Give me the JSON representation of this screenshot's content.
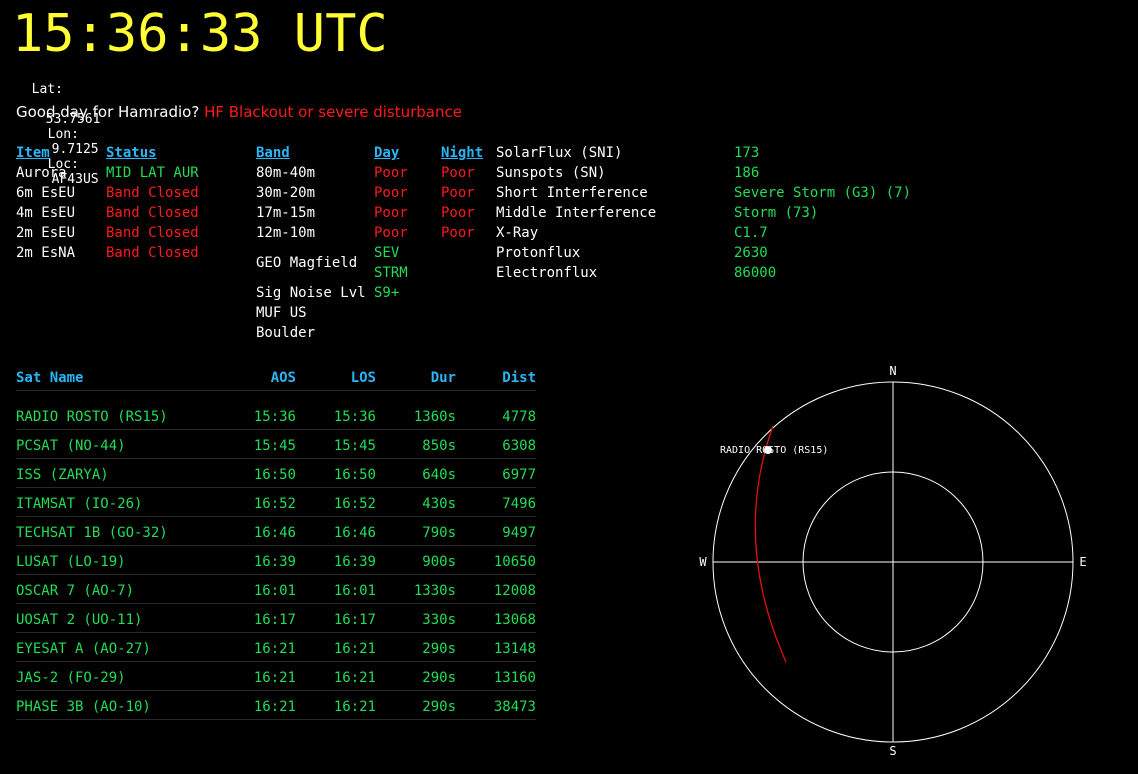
{
  "clock": "15:36:33 UTC",
  "location": {
    "lat_label": "Lat:",
    "lat": "53.7561",
    "lon_label": "Lon:",
    "lon": "9.7125",
    "loc_label": "Loc:",
    "loc": "AF43US"
  },
  "conditions": {
    "prefix": "Good day for Hamradio?",
    "status": "HF Blackout or severe disturbance"
  },
  "vhf": {
    "headers": {
      "item": "Item",
      "status": "Status"
    },
    "rows": [
      {
        "item": "Aurora",
        "status": "MID LAT AUR"
      },
      {
        "item": "6m EsEU",
        "status": "Band Closed"
      },
      {
        "item": "4m EsEU",
        "status": "Band Closed"
      },
      {
        "item": "2m EsEU",
        "status": "Band Closed"
      },
      {
        "item": "2m EsNA",
        "status": "Band Closed"
      }
    ]
  },
  "hf": {
    "headers": {
      "band": "Band",
      "day": "Day",
      "night": "Night"
    },
    "rows": [
      {
        "band": "80m-40m",
        "day": "Poor",
        "night": "Poor"
      },
      {
        "band": "30m-20m",
        "day": "Poor",
        "night": "Poor"
      },
      {
        "band": "17m-15m",
        "day": "Poor",
        "night": "Poor"
      },
      {
        "band": "12m-10m",
        "day": "Poor",
        "night": "Poor"
      }
    ],
    "extras": {
      "geo_label": "GEO Magfield",
      "geo_value_1": "SEV",
      "geo_value_2": "STRM",
      "noise_label": "Sig Noise Lvl",
      "noise_value": "S9+",
      "muf_label_1": "MUF US",
      "muf_label_2": "Boulder"
    }
  },
  "solar": {
    "rows": [
      {
        "label": "SolarFlux (SNI)",
        "value": "173"
      },
      {
        "label": "Sunspots (SN)",
        "value": "186"
      },
      {
        "label": "Short Interference",
        "value": "Severe Storm (G3) (7)"
      },
      {
        "label": "Middle Interference",
        "value": "Storm (73)"
      },
      {
        "label": "X-Ray",
        "value": "C1.7"
      },
      {
        "label": "Protonflux",
        "value": "2630"
      },
      {
        "label": "Electronflux",
        "value": "86000"
      }
    ]
  },
  "satellites": {
    "headers": {
      "name": "Sat Name",
      "aos": "AOS",
      "los": "LOS",
      "dur": "Dur",
      "dist": "Dist"
    },
    "rows": [
      {
        "name": "RADIO ROSTO (RS15)",
        "aos": "15:36",
        "los": "15:36",
        "dur": "1360s",
        "dist": "4778"
      },
      {
        "name": "PCSAT (NO-44)",
        "aos": "15:45",
        "los": "15:45",
        "dur": "850s",
        "dist": "6308"
      },
      {
        "name": "ISS (ZARYA)",
        "aos": "16:50",
        "los": "16:50",
        "dur": "640s",
        "dist": "6977"
      },
      {
        "name": "ITAMSAT (IO-26)",
        "aos": "16:52",
        "los": "16:52",
        "dur": "430s",
        "dist": "7496"
      },
      {
        "name": "TECHSAT 1B (GO-32)",
        "aos": "16:46",
        "los": "16:46",
        "dur": "790s",
        "dist": "9497"
      },
      {
        "name": "LUSAT (LO-19)",
        "aos": "16:39",
        "los": "16:39",
        "dur": "900s",
        "dist": "10650"
      },
      {
        "name": "OSCAR 7 (AO-7)",
        "aos": "16:01",
        "los": "16:01",
        "dur": "1330s",
        "dist": "12008"
      },
      {
        "name": "UOSAT 2 (UO-11)",
        "aos": "16:17",
        "los": "16:17",
        "dur": "330s",
        "dist": "13068"
      },
      {
        "name": "EYESAT A (AO-27)",
        "aos": "16:21",
        "los": "16:21",
        "dur": "290s",
        "dist": "13148"
      },
      {
        "name": "JAS-2 (FO-29)",
        "aos": "16:21",
        "los": "16:21",
        "dur": "290s",
        "dist": "13160"
      },
      {
        "name": "PHASE 3B (AO-10)",
        "aos": "16:21",
        "los": "16:21",
        "dur": "290s",
        "dist": "38473"
      }
    ]
  },
  "polar": {
    "north": "N",
    "south": "S",
    "east": "E",
    "west": "W",
    "sat_label": "RADIO ROSTO (RS15)",
    "track_color": "#e01010"
  }
}
